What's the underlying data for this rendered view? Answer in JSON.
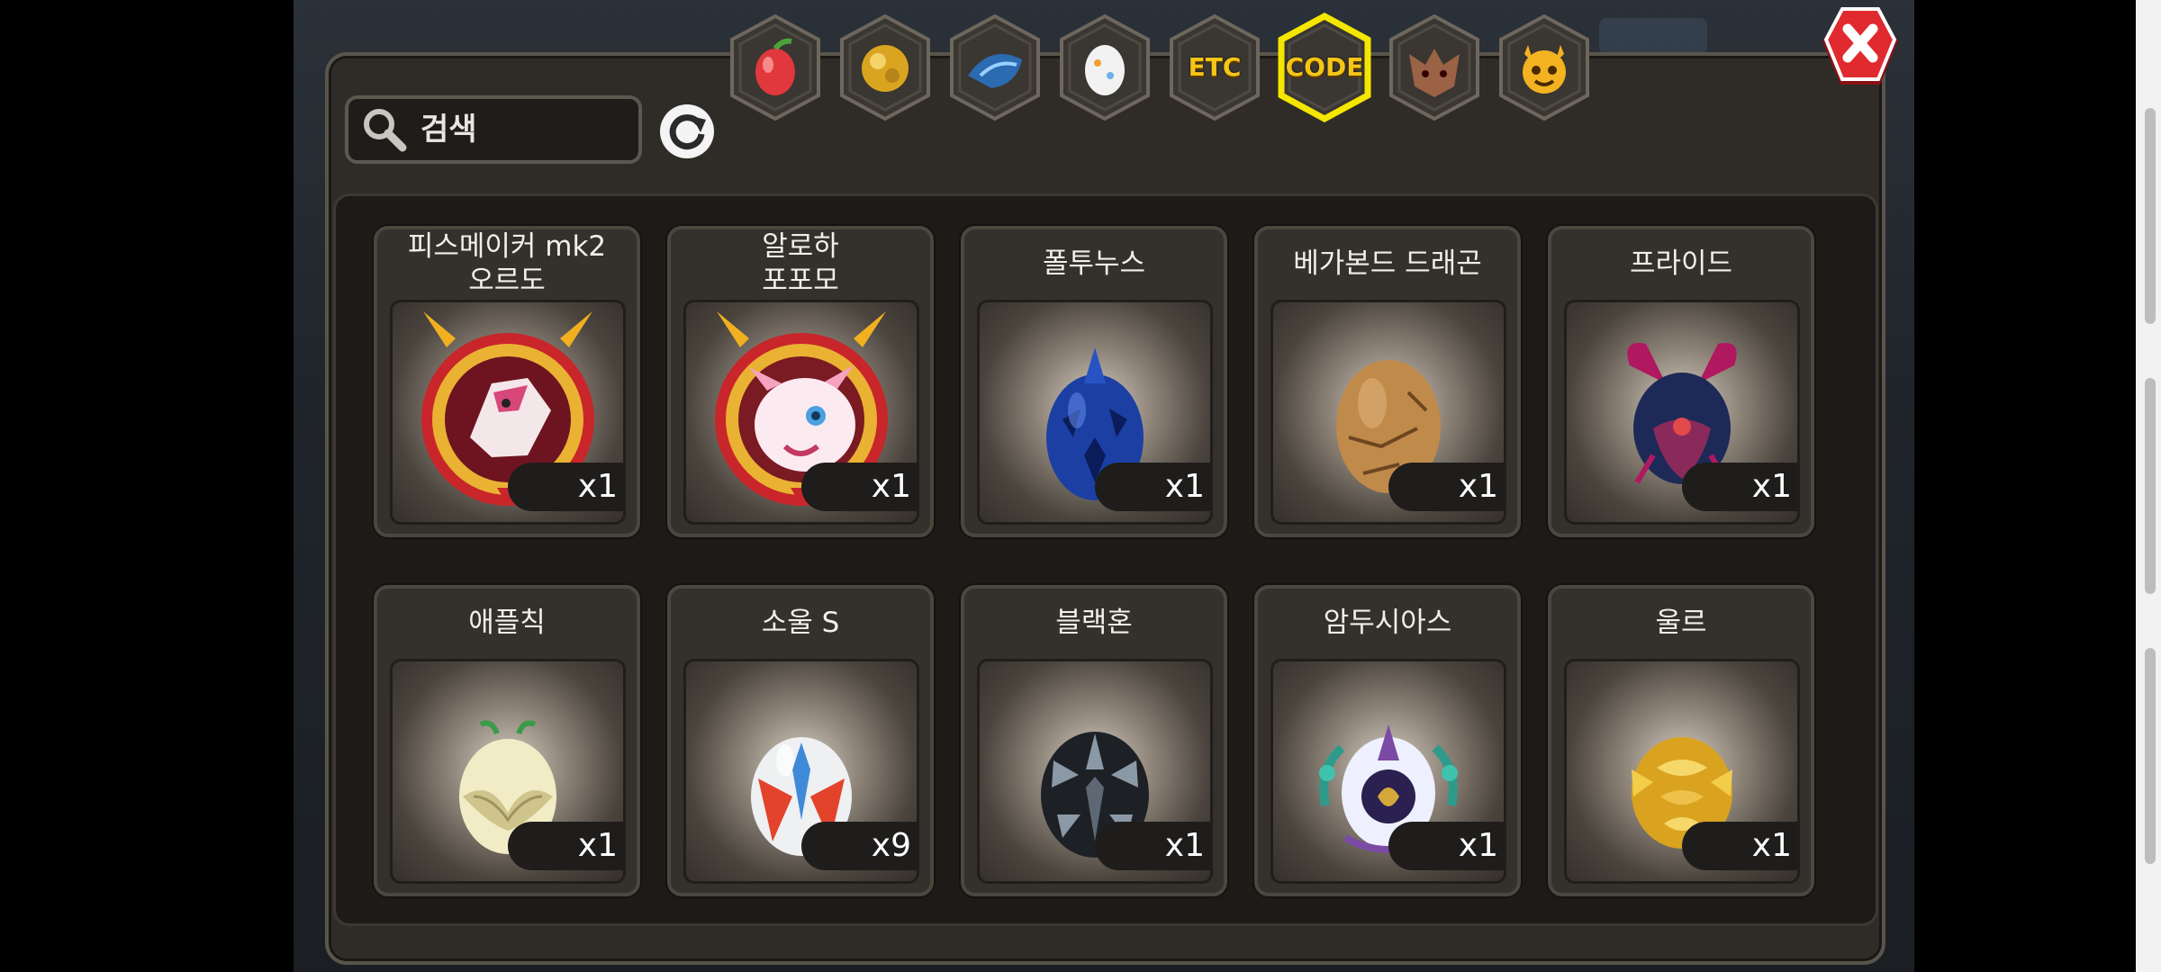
{
  "search": {
    "placeholder": "검색"
  },
  "tabs": [
    {
      "name": "fruit",
      "icon": "red-fruit-icon",
      "label": ""
    },
    {
      "name": "gold",
      "icon": "gold-nugget-icon",
      "label": ""
    },
    {
      "name": "scale",
      "icon": "blue-scale-icon",
      "label": ""
    },
    {
      "name": "egg",
      "icon": "egg-icon",
      "label": ""
    },
    {
      "name": "etc",
      "icon": "",
      "label": "ETC"
    },
    {
      "name": "code",
      "icon": "",
      "label": "CODE",
      "active": true
    },
    {
      "name": "monster",
      "icon": "beast-head-icon",
      "label": ""
    },
    {
      "name": "emote",
      "icon": "yellow-face-icon",
      "label": ""
    }
  ],
  "items": [
    {
      "name": "피스메이커 mk2\n오르도",
      "qty": "x1",
      "icon": "medal-dragon-icon"
    },
    {
      "name": "알로하\n포포모",
      "qty": "x1",
      "icon": "medal-creature-icon"
    },
    {
      "name": "폴투누스",
      "qty": "x1",
      "icon": "blue-spiked-egg-icon"
    },
    {
      "name": "베가본드 드래곤",
      "qty": "x1",
      "icon": "brown-egg-icon"
    },
    {
      "name": "프라이드",
      "qty": "x1",
      "icon": "horned-dark-egg-icon"
    },
    {
      "name": "애플칙",
      "qty": "x1",
      "icon": "leaf-egg-icon"
    },
    {
      "name": "소울 S",
      "qty": "x9",
      "icon": "red-winged-egg-icon"
    },
    {
      "name": "블랙혼",
      "qty": "x1",
      "icon": "black-spiked-egg-icon"
    },
    {
      "name": "암두시아스",
      "qty": "x1",
      "icon": "laurel-crest-egg-icon"
    },
    {
      "name": "울르",
      "qty": "x1",
      "icon": "gold-scaled-egg-icon"
    }
  ],
  "colors": {
    "panel": "#2f2c28",
    "tab_active_border": "#f5e600",
    "close": "#d8262c",
    "label_gold": "#f5c518"
  }
}
